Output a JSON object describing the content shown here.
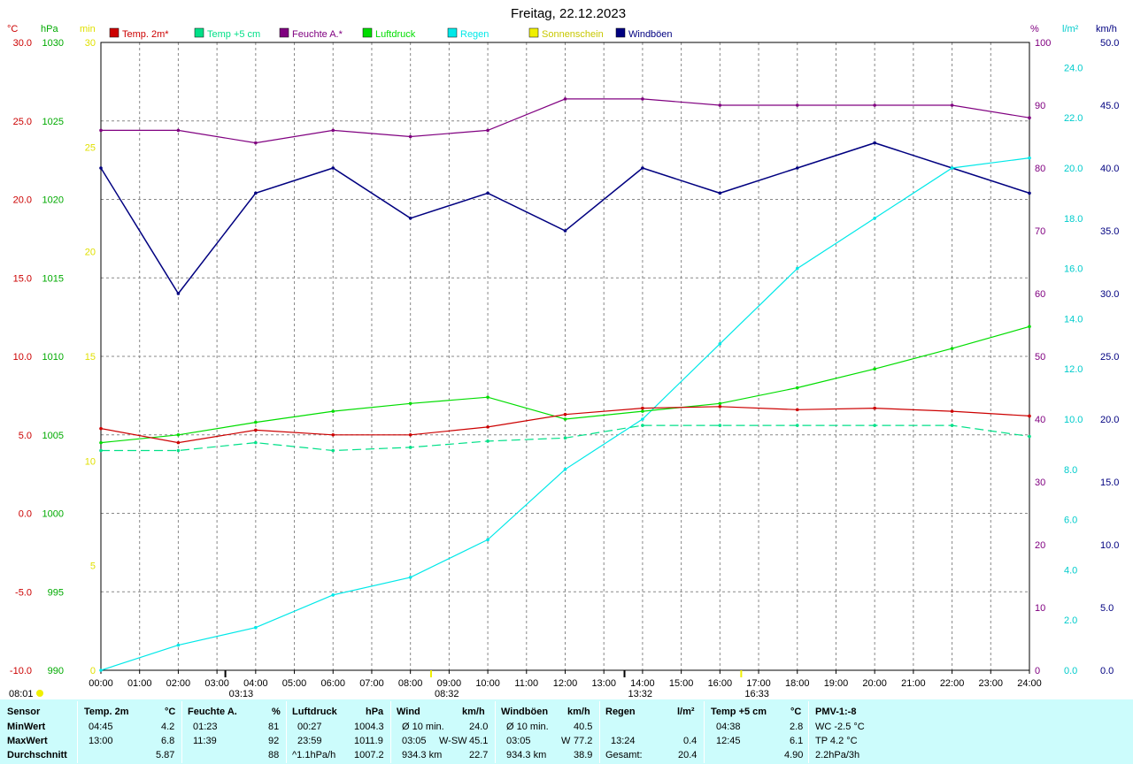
{
  "title": "Freitag, 22.12.2023",
  "legend": [
    {
      "label": "Temp. 2m*",
      "color": "#cc0000"
    },
    {
      "label": "Temp +5 cm",
      "color": "#00e088"
    },
    {
      "label": "Feuchte A.*",
      "color": "#800080"
    },
    {
      "label": "Luftdruck",
      "color": "#00dd00"
    },
    {
      "label": "Regen",
      "color": "#00e8e8"
    },
    {
      "label": "Sonnenschein",
      "color": "#f0f000"
    },
    {
      "label": "Windböen",
      "color": "#000080"
    }
  ],
  "axes": {
    "temp": {
      "unit": "°C",
      "ticks": [
        "30.0",
        "25.0",
        "20.0",
        "15.0",
        "10.0",
        "5.0",
        "0.0",
        "-5.0",
        "-10.0"
      ],
      "color": "#cc0000"
    },
    "pressure": {
      "unit": "hPa",
      "ticks": [
        "1030",
        "1025",
        "1020",
        "1015",
        "1010",
        "1005",
        "1000",
        "995",
        "990"
      ],
      "color": "#00aa00"
    },
    "sun": {
      "unit": "min",
      "ticks": [
        "30",
        "25",
        "20",
        "15",
        "10",
        "5",
        "0"
      ],
      "color": "#e0e000"
    },
    "humidity": {
      "unit": "%",
      "ticks": [
        "100",
        "90",
        "80",
        "70",
        "60",
        "50",
        "40",
        "30",
        "20",
        "10",
        "0"
      ],
      "color": "#800080"
    },
    "rain": {
      "unit": "l/m²",
      "ticks": [
        "24.0",
        "22.0",
        "20.0",
        "18.0",
        "16.0",
        "14.0",
        "12.0",
        "10.0",
        "8.0",
        "6.0",
        "4.0",
        "2.0",
        "0.0"
      ],
      "color": "#00cccc"
    },
    "wind": {
      "unit": "km/h",
      "ticks": [
        "50.0",
        "45.0",
        "40.0",
        "35.0",
        "30.0",
        "25.0",
        "20.0",
        "15.0",
        "10.0",
        "5.0",
        "0.0"
      ],
      "color": "#000080"
    },
    "time": [
      "00:00",
      "01:00",
      "02:00",
      "03:00",
      "04:00",
      "05:00",
      "06:00",
      "07:00",
      "08:00",
      "09:00",
      "10:00",
      "11:00",
      "12:00",
      "13:00",
      "14:00",
      "15:00",
      "16:00",
      "17:00",
      "18:00",
      "19:00",
      "20:00",
      "21:00",
      "22:00",
      "23:00",
      "24:00"
    ]
  },
  "markers": {
    "sunrise": "08:01",
    "sunset": "16:33",
    "sun_max": "08:32",
    "tmin": "03:13",
    "tmax": "13:32"
  },
  "chart_data": {
    "type": "line",
    "title": "Freitag, 22.12.2023",
    "x": [
      "00:00",
      "02:00",
      "04:00",
      "06:00",
      "08:00",
      "10:00",
      "12:00",
      "14:00",
      "16:00",
      "18:00",
      "20:00",
      "22:00",
      "24:00"
    ],
    "series": [
      {
        "name": "Temp. 2m*",
        "unit": "°C",
        "values": [
          5.4,
          4.5,
          5.3,
          5.0,
          5.0,
          5.5,
          6.3,
          6.7,
          6.8,
          6.6,
          6.7,
          6.5,
          6.2
        ]
      },
      {
        "name": "Temp +5 cm",
        "unit": "°C",
        "values": [
          4.0,
          4.0,
          4.5,
          4.0,
          4.2,
          4.6,
          4.8,
          5.6,
          5.6,
          5.6,
          5.6,
          5.6,
          4.9
        ]
      },
      {
        "name": "Feuchte A.*",
        "unit": "%",
        "values": [
          86,
          86,
          84,
          86,
          85,
          86,
          91,
          91,
          90,
          90,
          90,
          90,
          88
        ]
      },
      {
        "name": "Luftdruck",
        "unit": "hPa",
        "values": [
          1004.5,
          1005.0,
          1005.8,
          1006.5,
          1007.0,
          1007.4,
          1006.0,
          1006.5,
          1007.0,
          1008.0,
          1009.2,
          1010.5,
          1011.9
        ]
      },
      {
        "name": "Regen",
        "unit": "l/m²",
        "values": [
          0.0,
          1.0,
          1.7,
          3.0,
          3.7,
          5.2,
          8.0,
          10.0,
          13.0,
          16.0,
          18.0,
          20.0,
          20.4
        ]
      },
      {
        "name": "Windböen",
        "unit": "km/h",
        "values": [
          40,
          30,
          38,
          40,
          36,
          38,
          35,
          40,
          38,
          40,
          42,
          40,
          38
        ]
      }
    ],
    "y_ranges": {
      "temp": [
        -10,
        30
      ],
      "pressure": [
        990,
        1030
      ],
      "sun": [
        0,
        30
      ],
      "humidity": [
        0,
        100
      ],
      "rain": [
        0,
        25
      ],
      "wind": [
        0,
        50
      ]
    },
    "grid": true
  },
  "stats": {
    "headers": {
      "sensor": "Sensor",
      "temp": "Temp. 2m",
      "temp_unit": "°C",
      "hum": "Feuchte A.",
      "hum_unit": "%",
      "press": "Luftdruck",
      "press_unit": "hPa",
      "wind": "Wind",
      "wind_unit": "km/h",
      "gust": "Windböen",
      "gust_unit": "km/h",
      "rain": "Regen",
      "rain_unit": "l/m²",
      "t5": "Temp +5 cm",
      "t5_unit": "°C",
      "pmv": "PMV-1:-8"
    },
    "rows": [
      {
        "label": "MinWert",
        "temp_t": "04:45",
        "temp_v": "4.2",
        "hum_t": "01:23",
        "hum_v": "81",
        "press_t": "00:27",
        "press_v": "1004.3",
        "wind_t": "Ø 10 min.",
        "wind_d": "",
        "wind_v": "24.0",
        "gust_t": "Ø 10 min.",
        "gust_d": "",
        "gust_v": "40.5",
        "rain_t": "",
        "rain_v": "",
        "t5_t": "04:38",
        "t5_v": "2.8",
        "pmv": "WC -2.5 °C"
      },
      {
        "label": "MaxWert",
        "temp_t": "13:00",
        "temp_v": "6.8",
        "hum_t": "11:39",
        "hum_v": "92",
        "press_t": "23:59",
        "press_v": "1011.9",
        "wind_t": "03:05",
        "wind_d": "W-SW",
        "wind_v": "45.1",
        "gust_t": "03:05",
        "gust_d": "W",
        "gust_v": "77.2",
        "rain_t": "13:24",
        "rain_v": "0.4",
        "t5_t": "12:45",
        "t5_v": "6.1",
        "pmv": "TP 4.2 °C"
      },
      {
        "label": "Durchschnitt",
        "temp_t": "",
        "temp_v": "5.87",
        "hum_t": "",
        "hum_v": "88",
        "press_t": "^1.1hPa/h",
        "press_v": "1007.2",
        "wind_t": "934.3 km",
        "wind_d": "",
        "wind_v": "22.7",
        "gust_t": "934.3 km",
        "gust_d": "",
        "gust_v": "38.9",
        "rain_t": "Gesamt:",
        "rain_v": "20.4",
        "t5_t": "",
        "t5_v": "4.90",
        "pmv": "2.2hPa/3h"
      }
    ]
  }
}
